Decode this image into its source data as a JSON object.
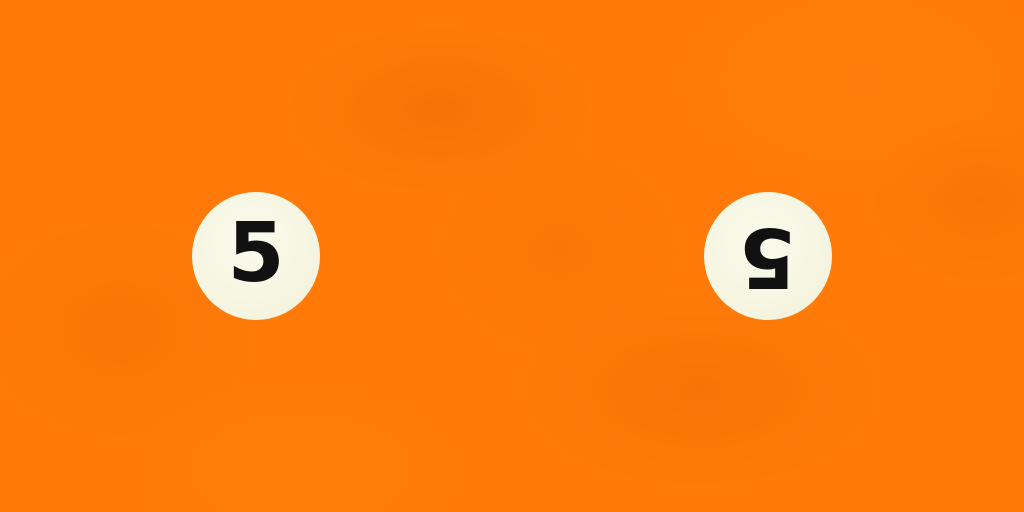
{
  "texture": {
    "background_color": "#ff7a08",
    "spot_color": "#f4f4df",
    "number_color": "#111111"
  },
  "ball": {
    "number": "5",
    "spots": [
      {
        "number": "5",
        "orientation": "upright"
      },
      {
        "number": "5",
        "orientation": "upside-down"
      }
    ]
  }
}
